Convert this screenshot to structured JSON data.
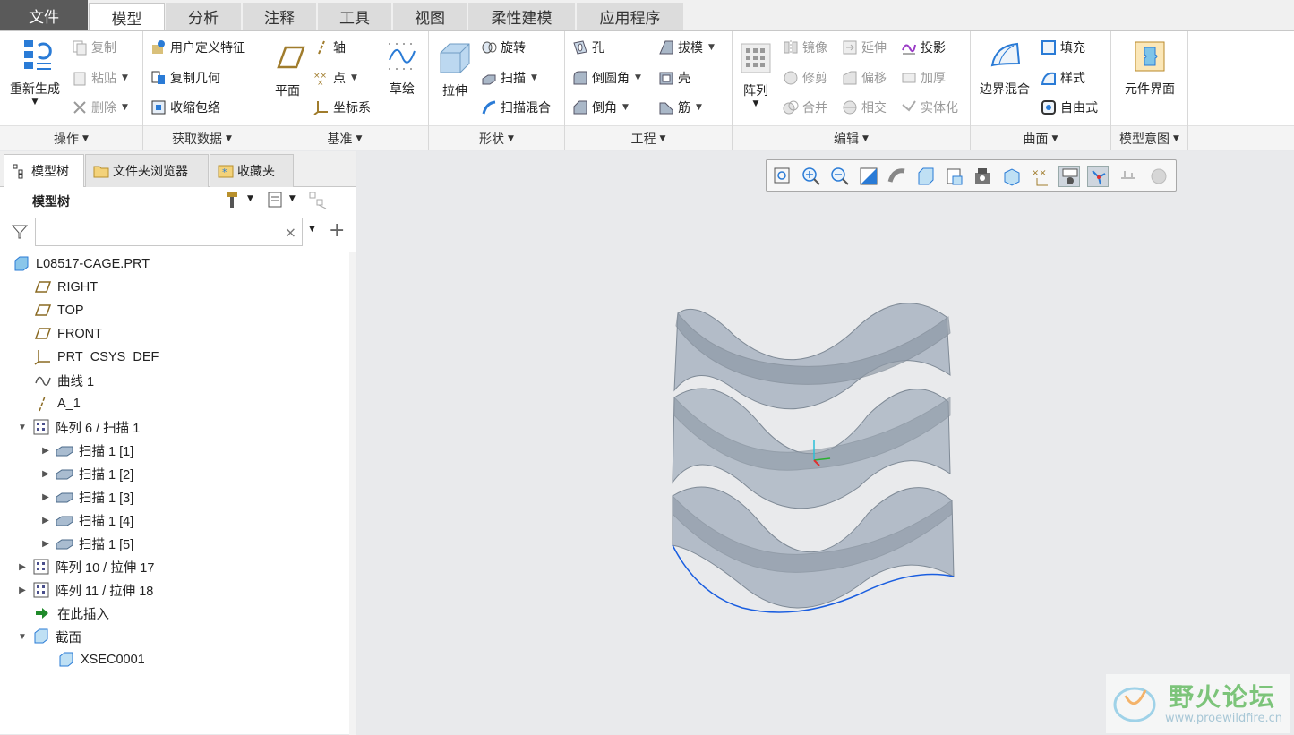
{
  "tabs": [
    "文件",
    "模型",
    "分析",
    "注释",
    "工具",
    "视图",
    "柔性建模",
    "应用程序"
  ],
  "groups": {
    "operations": {
      "footer": "操作",
      "regenerate": "重新生成",
      "copy": "复制",
      "paste": "粘贴",
      "delete": "删除"
    },
    "getdata": {
      "footer": "获取数据",
      "udf": "用户定义特征",
      "copy_geom": "复制几何",
      "shrinkwrap": "收缩包络"
    },
    "datum": {
      "footer": "基准",
      "plane": "平面",
      "axis": "轴",
      "point": "点",
      "csys": "坐标系",
      "sketch": "草绘"
    },
    "shapes": {
      "footer": "形状",
      "extrude": "拉伸",
      "revolve": "旋转",
      "sweep": "扫描",
      "swept_blend": "扫描混合"
    },
    "engineering": {
      "footer": "工程",
      "hole": "孔",
      "round": "倒圆角",
      "chamfer": "倒角",
      "draft": "拔模",
      "shell": "壳",
      "rib": "筋"
    },
    "editing": {
      "footer": "编辑",
      "pattern": "阵列",
      "mirror": "镜像",
      "trim": "修剪",
      "merge": "合并",
      "extend": "延伸",
      "offset": "偏移",
      "intersect": "相交",
      "project": "投影",
      "thicken": "加厚",
      "solidify": "实体化"
    },
    "surfaces": {
      "footer": "曲面",
      "boundary_blend": "边界混合",
      "fill": "填充",
      "style": "样式",
      "freestyle": "自由式"
    },
    "intent": {
      "footer": "模型意图",
      "component_interface": "元件界面"
    }
  },
  "panel": {
    "tabs": [
      "模型树",
      "文件夹浏览器",
      "收藏夹"
    ],
    "title": "模型树",
    "search_value": "",
    "tree": [
      "L08517-CAGE.PRT",
      "RIGHT",
      "TOP",
      "FRONT",
      "PRT_CSYS_DEF",
      "曲线 1",
      "A_1",
      "阵列 6 / 扫描 1",
      "扫描 1 [1]",
      "扫描 1 [2]",
      "扫描 1 [3]",
      "扫描 1 [4]",
      "扫描 1 [5]",
      "阵列 10 / 拉伸 17",
      "阵列 11 / 拉伸 18",
      "在此插入",
      "截面",
      "XSEC0001"
    ]
  },
  "watermark": {
    "title": "野火论坛",
    "url": "www.proewildfire.cn"
  },
  "colors": {
    "accent": "#1a73e8",
    "file_tab": "#5a5a5a",
    "model_blue": "#aeb7c3"
  }
}
